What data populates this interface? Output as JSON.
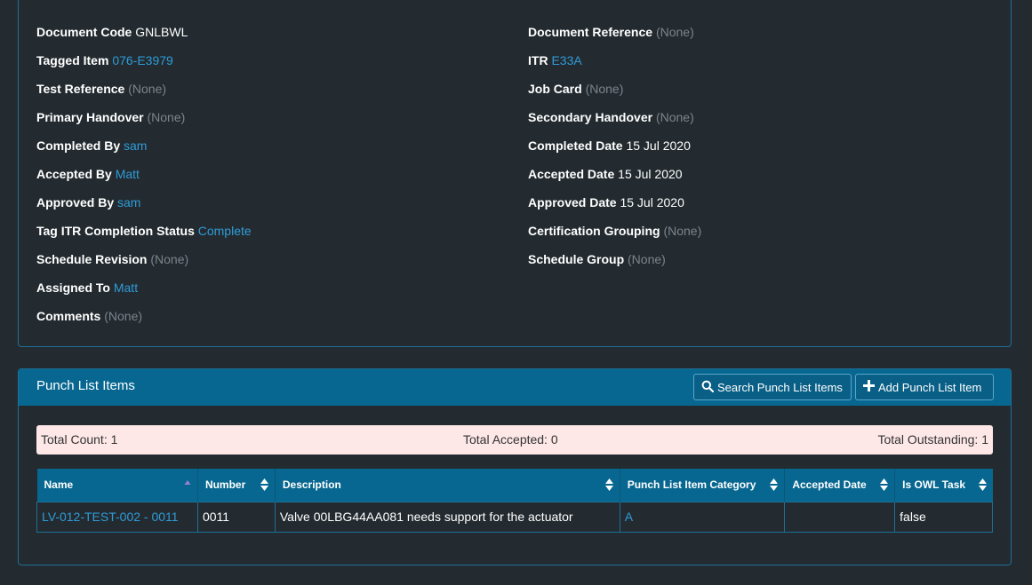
{
  "details": {
    "left": [
      {
        "label": "Document Code",
        "value": "GNLBWL",
        "kind": "plain"
      },
      {
        "label": "Tagged Item",
        "value": "076-E3979",
        "kind": "link"
      },
      {
        "label": "Test Reference",
        "value": "(None)",
        "kind": "none"
      },
      {
        "label": "Primary Handover",
        "value": "(None)",
        "kind": "none"
      },
      {
        "label": "Completed By",
        "value": "sam",
        "kind": "link"
      },
      {
        "label": "Accepted By",
        "value": "Matt",
        "kind": "link"
      },
      {
        "label": "Approved By",
        "value": "sam",
        "kind": "link"
      },
      {
        "label": "Tag ITR Completion Status",
        "value": "Complete",
        "kind": "link"
      },
      {
        "label": "Schedule Revision",
        "value": "(None)",
        "kind": "none"
      },
      {
        "label": "Assigned To",
        "value": "Matt",
        "kind": "link"
      },
      {
        "label": "Comments",
        "value": "(None)",
        "kind": "none"
      }
    ],
    "right": [
      {
        "label": "Document Reference",
        "value": "(None)",
        "kind": "none"
      },
      {
        "label": "ITR",
        "value": "E33A",
        "kind": "link"
      },
      {
        "label": "Job Card",
        "value": "(None)",
        "kind": "none"
      },
      {
        "label": "Secondary Handover",
        "value": "(None)",
        "kind": "none"
      },
      {
        "label": "Completed Date",
        "value": "15 Jul 2020",
        "kind": "plain"
      },
      {
        "label": "Accepted Date",
        "value": "15 Jul 2020",
        "kind": "plain"
      },
      {
        "label": "Approved Date",
        "value": "15 Jul 2020",
        "kind": "plain"
      },
      {
        "label": "Certification Grouping",
        "value": "(None)",
        "kind": "none"
      },
      {
        "label": "Schedule Group",
        "value": "(None)",
        "kind": "none"
      }
    ]
  },
  "punch": {
    "title": "Punch List Items",
    "search_button": "Search Punch List Items",
    "add_button": "Add Punch List Item",
    "totals": {
      "count": "Total Count: 1",
      "accepted": "Total Accepted: 0",
      "outstanding": "Total Outstanding: 1"
    },
    "columns": [
      "Name",
      "Number",
      "Description",
      "Punch List Item Category",
      "Accepted Date",
      "Is OWL Task"
    ],
    "rows": [
      {
        "name": "LV-012-TEST-002 - 0011",
        "number": "0011",
        "description": "Valve 00LBG44AA081 needs support for the actuator",
        "category": "A",
        "accepted_date": "",
        "is_owl_task": "false"
      }
    ]
  },
  "colors": {
    "background": "#232b30",
    "link": "#2f9bd8",
    "none_text": "#7c858b",
    "header_blue": "#076790",
    "panel_border": "#1e6f96",
    "totals_bg": "#fde7e7"
  }
}
